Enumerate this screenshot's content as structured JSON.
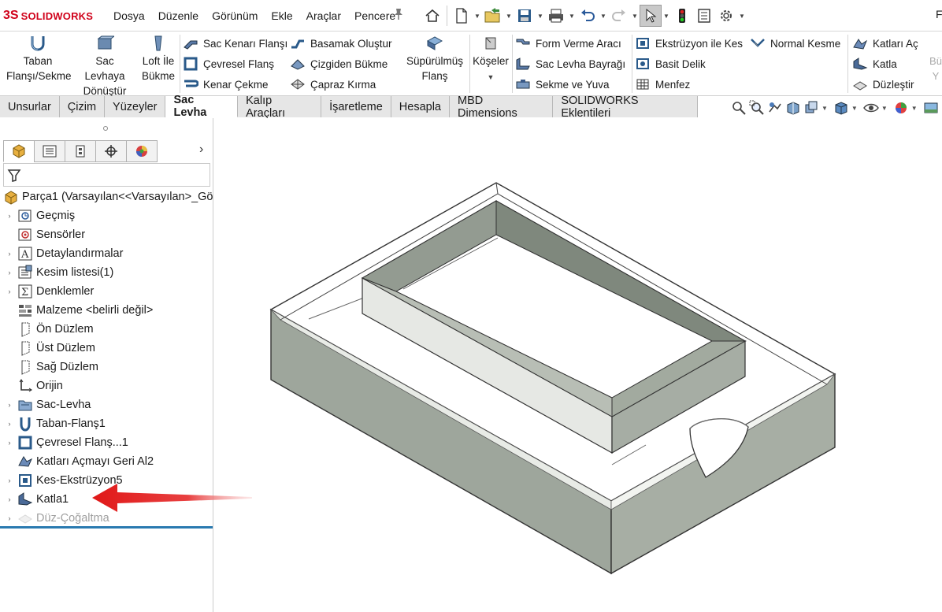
{
  "app": {
    "logo_text": "SOLIDWORKS",
    "logo_mark": "3S"
  },
  "menu": [
    "Dosya",
    "Düzenle",
    "Görünüm",
    "Ekle",
    "Araçlar",
    "Pencere"
  ],
  "quick_access": [
    "home-icon",
    "new-document-icon",
    "open-icon",
    "save-icon",
    "print-icon",
    "undo-icon",
    "redo-icon",
    "select-arrow-icon",
    "traffic-light-icon",
    "file-properties-icon",
    "options-gear-icon"
  ],
  "top_right_cut": "F",
  "ribbon": {
    "big": [
      {
        "label1": "Taban",
        "label2": "Flanşı/Sekme"
      },
      {
        "label1": "Sac Levhaya",
        "label2": "Dönüştür"
      },
      {
        "label1": "Loft İle",
        "label2": "Bükme"
      },
      {
        "label1": "Süpürülmüş",
        "label2": "Flanş"
      },
      {
        "label1": "Köşeler",
        "label2": ""
      }
    ],
    "col1": [
      "Sac Kenarı Flanşı",
      "Çevresel Flanş",
      "Kenar Çekme"
    ],
    "col2": [
      "Basamak Oluştur",
      "Çizgiden Bükme",
      "Çapraz Kırma"
    ],
    "col3": [
      "Form Verme Aracı",
      "Sac Levha Bayrağı",
      "Sekme ve Yuva"
    ],
    "col4": [
      "Ekstrüzyon ile Kes",
      "Basit Delik",
      "Menfez"
    ],
    "col5": [
      "Normal Kesme"
    ],
    "col6": [
      "Katları Aç",
      "Katla",
      "Düzleştir"
    ],
    "cut": {
      "line1": "Bü",
      "line2": "Y"
    }
  },
  "tabs": [
    {
      "label": "Unsurlar",
      "active": false
    },
    {
      "label": "Çizim",
      "active": false
    },
    {
      "label": "Yüzeyler",
      "active": false
    },
    {
      "label": "Sac Levha",
      "active": true
    },
    {
      "label": "Kalıp Araçları",
      "active": false
    },
    {
      "label": "İşaretleme",
      "active": false
    },
    {
      "label": "Hesapla",
      "active": false
    },
    {
      "label": "MBD Dimensions",
      "active": false
    },
    {
      "label": "SOLIDWORKS Eklentileri",
      "active": false
    }
  ],
  "tree": [
    {
      "label": "Parça1  (Varsayılan<<Varsayılan>_Gö",
      "expander": "none",
      "icon": "part-icon",
      "grey": false
    },
    {
      "label": "Geçmiş",
      "expander": "›",
      "icon": "history-icon",
      "grey": false
    },
    {
      "label": "Sensörler",
      "expander": "none",
      "icon": "sensor-icon",
      "grey": false
    },
    {
      "label": "Detaylandırmalar",
      "expander": "›",
      "icon": "annotations-icon",
      "grey": false
    },
    {
      "label": "Kesim listesi(1)",
      "expander": "›",
      "icon": "cut-list-icon",
      "grey": false
    },
    {
      "label": "Denklemler",
      "expander": "›",
      "icon": "equations-icon",
      "grey": false
    },
    {
      "label": "Malzeme <belirli değil>",
      "expander": "none",
      "icon": "material-icon",
      "grey": false
    },
    {
      "label": "Ön Düzlem",
      "expander": "none",
      "icon": "plane-icon",
      "grey": false
    },
    {
      "label": "Üst Düzlem",
      "expander": "none",
      "icon": "plane-icon",
      "grey": false
    },
    {
      "label": "Sağ Düzlem",
      "expander": "none",
      "icon": "plane-icon",
      "grey": false
    },
    {
      "label": "Orijin",
      "expander": "none",
      "icon": "origin-icon",
      "grey": false
    },
    {
      "label": "Sac-Levha",
      "expander": "›",
      "icon": "sheet-metal-folder-icon",
      "grey": false
    },
    {
      "label": "Taban-Flanş1",
      "expander": "›",
      "icon": "base-flange-icon",
      "grey": false
    },
    {
      "label": "Çevresel Flanş...1",
      "expander": "›",
      "icon": "miter-flange-icon",
      "grey": false
    },
    {
      "label": "Katları Açmayı Geri Al2",
      "expander": "none",
      "icon": "unfold-icon",
      "grey": false
    },
    {
      "label": "Kes-Ekstrüzyon5",
      "expander": "›",
      "icon": "extruded-cut-icon",
      "grey": false
    },
    {
      "label": "Katla1",
      "expander": "›",
      "icon": "fold-icon",
      "grey": false
    },
    {
      "label": "Düz-Çoğaltma",
      "expander": "›",
      "icon": "flat-pattern-icon",
      "grey": true
    }
  ]
}
